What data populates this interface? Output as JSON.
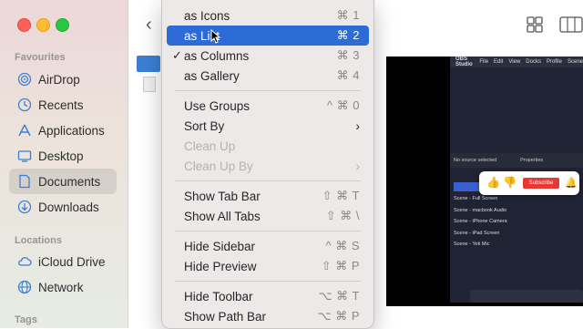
{
  "sidebar": {
    "favourites_heading": "Favourites",
    "favourites": [
      {
        "label": "AirDrop",
        "icon": "airdrop-icon"
      },
      {
        "label": "Recents",
        "icon": "clock-icon"
      },
      {
        "label": "Applications",
        "icon": "applications-icon"
      },
      {
        "label": "Desktop",
        "icon": "desktop-icon"
      },
      {
        "label": "Documents",
        "icon": "document-icon",
        "selected": true
      },
      {
        "label": "Downloads",
        "icon": "download-icon"
      }
    ],
    "locations_heading": "Locations",
    "locations": [
      {
        "label": "iCloud Drive",
        "icon": "cloud-icon"
      },
      {
        "label": "Network",
        "icon": "globe-icon"
      }
    ],
    "tags_heading": "Tags"
  },
  "menu": {
    "items": [
      {
        "label": "as Icons",
        "shortcut": "⌘ 1"
      },
      {
        "label": "as List",
        "shortcut": "⌘ 2",
        "highlighted": true
      },
      {
        "label": "as Columns",
        "shortcut": "⌘ 3",
        "checked": true
      },
      {
        "label": "as Gallery",
        "shortcut": "⌘ 4"
      },
      {
        "label": "Use Groups",
        "shortcut": "^ ⌘ 0"
      },
      {
        "label": "Sort By",
        "submenu": true
      },
      {
        "label": "Clean Up",
        "disabled": true
      },
      {
        "label": "Clean Up By",
        "disabled": true,
        "submenu": true
      },
      {
        "label": "Show Tab Bar",
        "shortcut": "⇧ ⌘ T"
      },
      {
        "label": "Show All Tabs",
        "shortcut": "⇧ ⌘ \\"
      },
      {
        "label": "Hide Sidebar",
        "shortcut": "^ ⌘ S"
      },
      {
        "label": "Hide Preview",
        "shortcut": "⇧ ⌘ P"
      },
      {
        "label": "Hide Toolbar",
        "shortcut": "⌥ ⌘ T"
      },
      {
        "label": "Show Path Bar",
        "shortcut": "⌥ ⌘ P"
      }
    ]
  },
  "preview": {
    "app_title": "OBS Studio",
    "menubar": [
      "File",
      "Edit",
      "View",
      "Docks",
      "Profile",
      "Scene"
    ],
    "no_source": "No source selected",
    "properties": "Properties",
    "scenes": [
      "Scene - Full Screen",
      "Scene - macbook Audio",
      "Scene - iPhone Camera",
      "Scene - iPad Screen",
      "Scene - Yeti Mic"
    ],
    "subscribe": "Subscribe"
  },
  "colors": {
    "highlight": "#2d6bd6",
    "sidebar_selected": "rgba(0,0,0,0.09)"
  }
}
